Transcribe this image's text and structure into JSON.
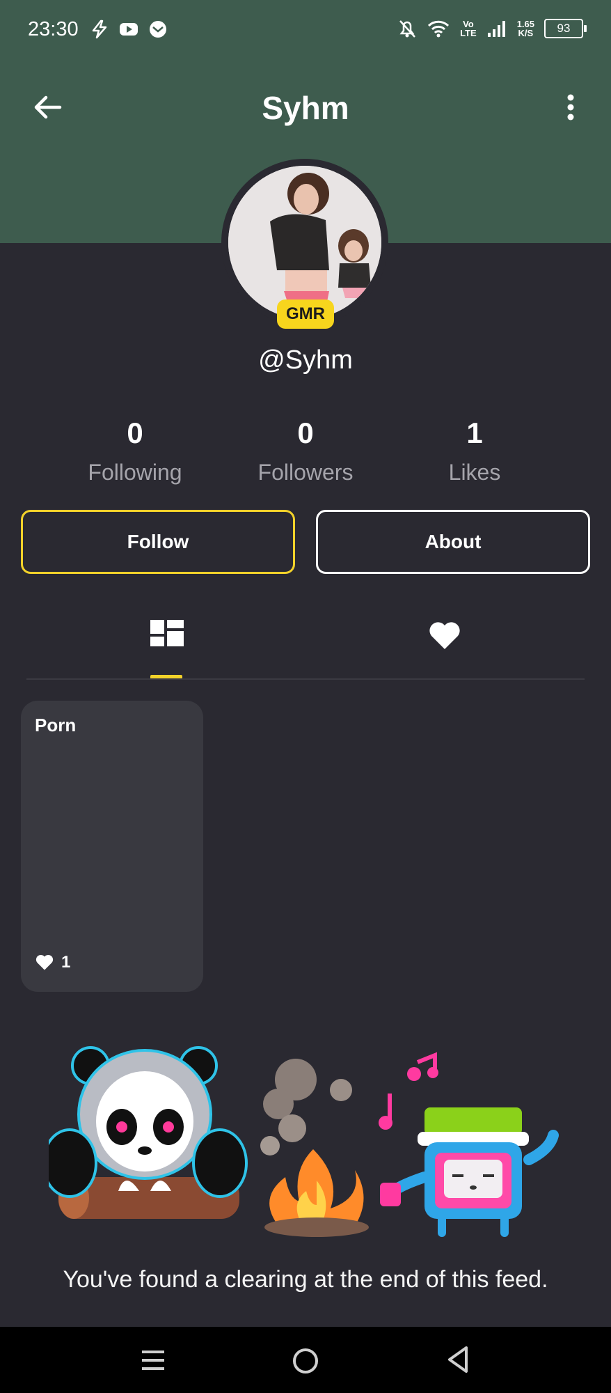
{
  "status_bar": {
    "time": "23:30",
    "left_icons": [
      "flash-icon",
      "youtube-icon",
      "message-icon"
    ],
    "right_icons": [
      "mute-bell-icon",
      "wifi-icon",
      "volte-icon",
      "signal-icon"
    ],
    "volte_top": "Vo",
    "volte_bottom": "LTE",
    "speed_value": "1.65",
    "speed_unit": "K/S",
    "battery": "93"
  },
  "header": {
    "title": "Syhm",
    "back_icon": "arrow-left-icon",
    "more_icon": "more-vertical-icon"
  },
  "profile": {
    "badge": "GMR",
    "handle": "@Syhm"
  },
  "stats": [
    {
      "value": "0",
      "label": "Following"
    },
    {
      "value": "0",
      "label": "Followers"
    },
    {
      "value": "1",
      "label": "Likes"
    }
  ],
  "actions": {
    "follow_label": "Follow",
    "about_label": "About"
  },
  "tabs": {
    "posts_icon": "grid-icon",
    "likes_icon": "heart-icon",
    "active": "posts"
  },
  "posts": [
    {
      "title": "Porn",
      "likes": "1"
    }
  ],
  "feed_end": {
    "message": "You've found a clearing at the end of this feed."
  },
  "colors": {
    "header_green": "#3e5c4e",
    "background": "#2a2931",
    "accent_yellow": "#f3d22a",
    "card": "#393940"
  }
}
